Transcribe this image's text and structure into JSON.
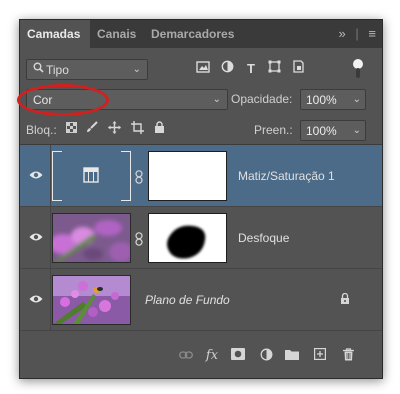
{
  "tabs": [
    {
      "label": "Camadas",
      "active": true
    },
    {
      "label": "Canais",
      "active": false
    },
    {
      "label": "Demarcadores",
      "active": false
    }
  ],
  "panel_menu": {
    "expand_icon": "double-chevron-right-icon",
    "menu_icon": "hamburger-icon"
  },
  "filter": {
    "type_label": "Tipo",
    "icons": [
      "pixel-filter-icon",
      "adjustment-filter-icon",
      "type-filter-icon",
      "shape-filter-icon",
      "smart-object-filter-icon"
    ]
  },
  "blend": {
    "mode": "Cor",
    "highlight_color": "#d41f1f"
  },
  "opacity": {
    "label": "Opacidade:",
    "value": "100%"
  },
  "lock": {
    "label": "Bloq.:",
    "icons": [
      "lock-transparency-icon",
      "lock-image-icon",
      "lock-position-icon",
      "lock-artboard-icon",
      "lock-all-icon"
    ]
  },
  "fill": {
    "label": "Preen.:",
    "value": "100%"
  },
  "layers": [
    {
      "name": "Matiz/Saturação 1",
      "selected": true,
      "type": "adjustment",
      "mask": "white"
    },
    {
      "name": "Desfoque",
      "selected": false,
      "type": "image",
      "mask": "black-blob"
    },
    {
      "name": "Plano de Fundo",
      "selected": false,
      "type": "background",
      "locked": true
    }
  ],
  "footer_tools": [
    "link-layers-icon",
    "fx-icon",
    "add-mask-icon",
    "new-adjustment-icon",
    "new-group-icon",
    "new-layer-icon",
    "delete-layer-icon"
  ],
  "footer_fx": "fx",
  "colors": {
    "panel_bg": "#535353",
    "selected_row": "#4b6b88",
    "tab_bar": "#3a3a3a"
  }
}
